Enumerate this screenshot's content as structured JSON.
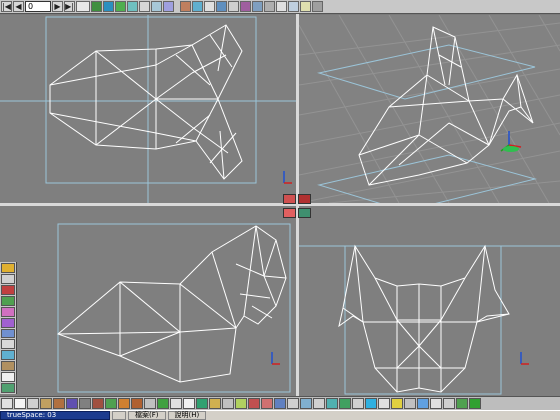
{
  "toolbar_top": {
    "frame_value": "0",
    "buttons": [
      "go-first-icon",
      "play-back-icon",
      "frame-input",
      "play-forward-icon",
      "go-last-icon",
      "dopesheet-icon",
      "move-tool-icon",
      "rotate-tool-icon",
      "scale-tool-icon",
      "pose-tool-icon",
      "skeleton-icon",
      "morph-icon",
      "lattice-icon",
      "render-icon",
      "camera-icon",
      "light-icon",
      "grid-icon",
      "deform-icon",
      "pin-icon",
      "snap-icon",
      "chart-icon",
      "undo-icon",
      "group-icon",
      "light-bulb-icon",
      "up-arrow-icon"
    ],
    "glyphs": {
      "go_first": "|◀",
      "play_back": "◀",
      "play_forward": "▶",
      "go_last": "▶|"
    }
  },
  "viewports": [
    {
      "id": "top",
      "label": "top-view"
    },
    {
      "id": "perspective",
      "label": "perspective-view"
    },
    {
      "id": "front",
      "label": "front-view"
    },
    {
      "id": "side",
      "label": "side-view"
    }
  ],
  "toolbar_left": {
    "buttons": [
      "select-tool-icon",
      "lasso-icon",
      "paint-icon",
      "material-icon",
      "face-icon",
      "palette-icon",
      "mesh-icon",
      "bone-icon",
      "uv-icon",
      "texture-icon",
      "sphere-icon",
      "magnet-icon"
    ]
  },
  "toolbar_bottom": {
    "buttons": [
      "cube-primitive-icon",
      "sphere-primitive-icon",
      "cylinder-primitive-icon",
      "cone-primitive-icon",
      "torus-primitive-icon",
      "plane-primitive-icon",
      "sphere2-primitive-icon",
      "disc-primitive-icon",
      "capsule-primitive-icon",
      "tube-primitive-icon",
      "spline-icon",
      "extrude-icon",
      "lathe-icon",
      "boolean-icon",
      "text-icon",
      "particles-icon",
      "paint-brush-icon",
      "eraser-icon",
      "smooth-icon",
      "paint-bucket-icon",
      "stamp-icon",
      "sculpt-icon",
      "flatten-icon",
      "inflate-icon",
      "pinch-icon",
      "crease-icon",
      "brush-icon",
      "mirror-icon",
      "camera-tool-icon",
      "light-tool-icon",
      "render-tool-icon",
      "wireframe-icon",
      "shaded-icon",
      "grid-toggle-icon",
      "snap-toggle-icon",
      "axis-icon",
      "help-icon"
    ]
  },
  "taskbar": {
    "items": [
      "trueSpace: 03",
      "",
      "檔案(F)",
      "說明(H)"
    ]
  },
  "colors": {
    "viewport_bg": "#7f7f7f",
    "wire": "#ffffff",
    "grid": "#8fb6c6",
    "bbox": "#9bc4d8",
    "toolbar": "#c8c8c8"
  }
}
